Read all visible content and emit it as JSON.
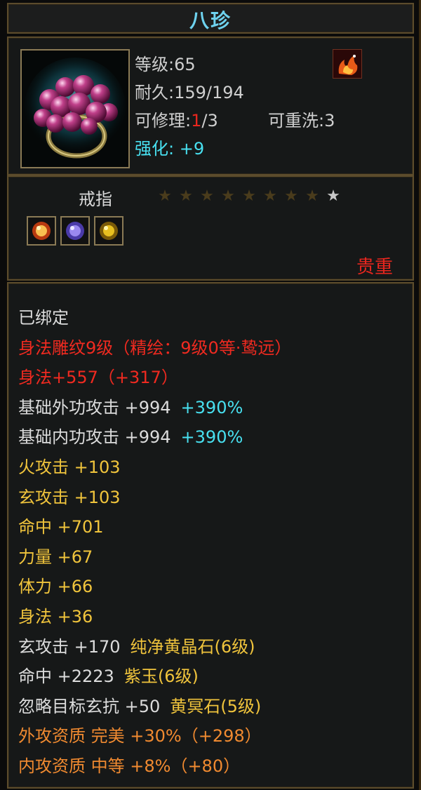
{
  "item": {
    "name": "八珍",
    "level_label": "等级:",
    "level": "65",
    "durability_label": "耐久:",
    "durability": "159/194",
    "repair_label": "可修理:",
    "repair_used": "1",
    "repair_total": "/3",
    "rewash_label": "可重洗:",
    "rewash": "3",
    "refine_label": "强化:",
    "refine": "+9",
    "type": "戒指",
    "stars_filled": 8,
    "stars_total": 9,
    "quality": "贵重"
  },
  "colors": {
    "title": "#6ed2ee",
    "star_filled": "#4a3c1c",
    "star_active": "#c8c8c8"
  },
  "stats": [
    {
      "text": "已绑定",
      "color": "white"
    },
    {
      "text": "身法雕纹9级（精绘：9级0等·鸷远）",
      "color": "red2"
    },
    {
      "text": "身法+557（+317）",
      "color": "red2"
    },
    {
      "text": "基础外功攻击  +994",
      "extra": "+390%",
      "color": "white"
    },
    {
      "text": "基础内功攻击  +994",
      "extra": "+390%",
      "color": "white"
    },
    {
      "text": "火攻击  +103",
      "color": "yellow"
    },
    {
      "text": "玄攻击  +103",
      "color": "yellow"
    },
    {
      "text": "命中  +701",
      "color": "yellow"
    },
    {
      "text": "力量  +67",
      "color": "yellow"
    },
    {
      "text": "体力  +66",
      "color": "yellow"
    },
    {
      "text": "身法  +36",
      "color": "yellow"
    },
    {
      "text": "玄攻击  +170",
      "extra": "纯净黄晶石(6级)",
      "color": "white",
      "extra_color": "yellow"
    },
    {
      "text": "命中  +2223",
      "extra": "紫玉(6级)",
      "color": "white",
      "extra_color": "yellow"
    },
    {
      "text": "忽略目标玄抗  +50",
      "extra": "黄冥石(5级)",
      "color": "white",
      "extra_color": "yellow"
    },
    {
      "text": "外攻资质   完美  +30%（+298）",
      "color": "orange"
    },
    {
      "text": "内攻资质   中等  +8%（+80）",
      "color": "orange"
    }
  ]
}
